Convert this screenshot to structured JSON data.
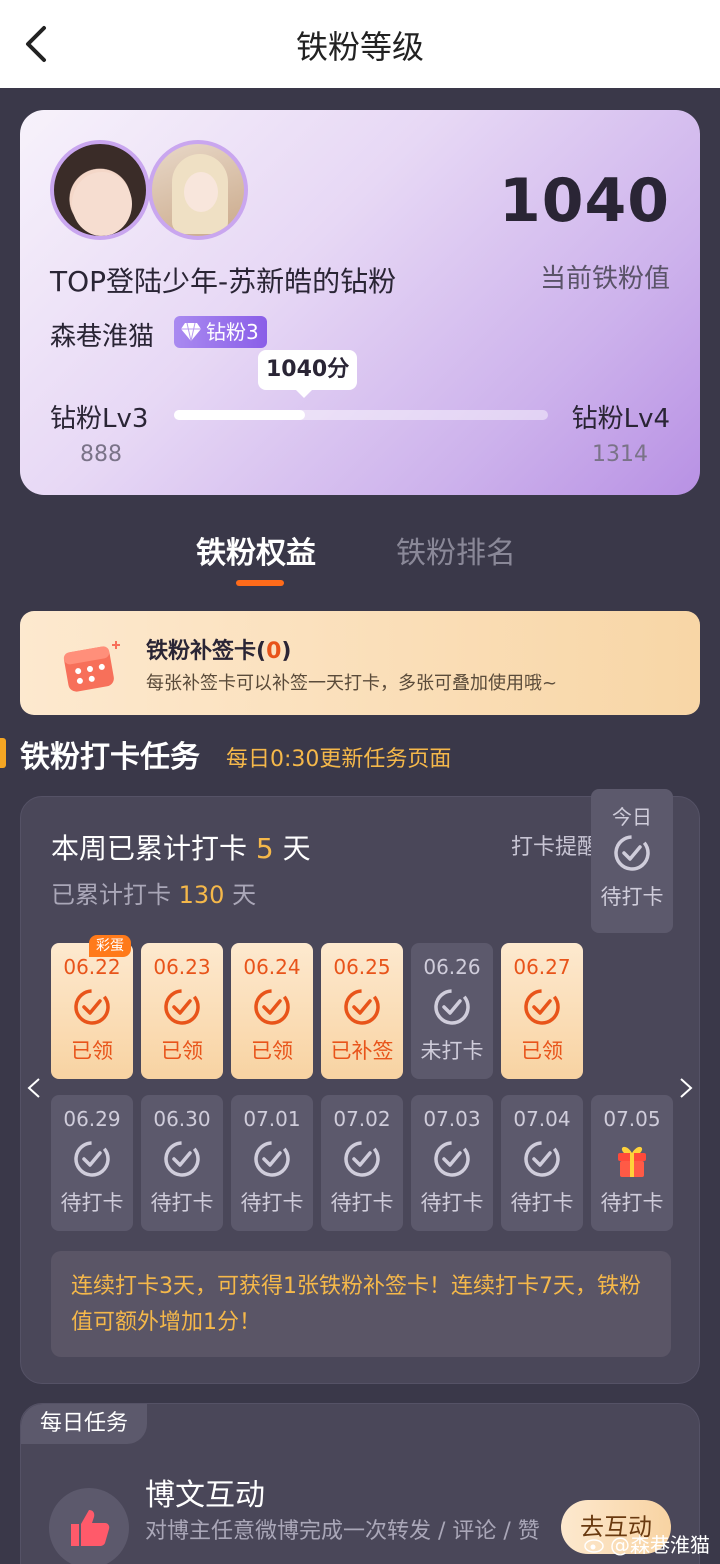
{
  "topbar": {
    "title": "铁粉等级"
  },
  "card": {
    "score": "1040",
    "score_label": "当前铁粉值",
    "fan_name": "TOP登陆少年-苏新皓的钻粉",
    "user_name": "森巷淮猫",
    "badge": "钻粉3",
    "bubble": "1040分",
    "level_left": "钻粉Lv3",
    "level_right": "钻粉Lv4",
    "level_left_num": "888",
    "level_right_num": "1314",
    "progress": 0.35
  },
  "tabs": {
    "active": "铁粉权益",
    "inactive": "铁粉排名"
  },
  "makeup": {
    "title_prefix": "铁粉补签卡(",
    "count": "0",
    "title_suffix": ")",
    "desc": "每张补签卡可以补签一天打卡，多张可叠加使用哦~"
  },
  "section": {
    "title": "铁粉打卡任务",
    "subtitle": "每日0:30更新任务页面"
  },
  "checkin": {
    "week_prefix": "本周已累计打卡 ",
    "week_days": "5",
    "week_suffix": " 天",
    "total_prefix": "已累计打卡 ",
    "total_days": "130",
    "total_suffix": " 天",
    "remind_label": "打卡提醒",
    "easter_tag": "彩蛋",
    "row1": [
      {
        "date": "06.22",
        "status": "已领"
      },
      {
        "date": "06.23",
        "status": "已领"
      },
      {
        "date": "06.24",
        "status": "已领"
      },
      {
        "date": "06.25",
        "status": "已补签"
      },
      {
        "date": "06.26",
        "status": "未打卡"
      },
      {
        "date": "06.27",
        "status": "已领"
      },
      {
        "date": "今日",
        "status": "待打卡"
      }
    ],
    "row2": [
      {
        "date": "06.29",
        "status": "待打卡"
      },
      {
        "date": "06.30",
        "status": "待打卡"
      },
      {
        "date": "07.01",
        "status": "待打卡"
      },
      {
        "date": "07.02",
        "status": "待打卡"
      },
      {
        "date": "07.03",
        "status": "待打卡"
      },
      {
        "date": "07.04",
        "status": "待打卡"
      },
      {
        "date": "07.05",
        "status": "待打卡"
      }
    ],
    "tip": "连续打卡3天，可获得1张铁粉补签卡！连续打卡7天，铁粉值可额外增加1分！"
  },
  "daily": {
    "tag": "每日任务",
    "title": "博文互动",
    "desc": "对博主任意微博完成一次转发 / 评论 / 赞",
    "button": "去互动"
  },
  "watermark": "@森巷淮猫",
  "colors": {
    "accent": "#e8541a",
    "gold": "#f5b84a",
    "toggle_on": "#2fbf5a"
  }
}
